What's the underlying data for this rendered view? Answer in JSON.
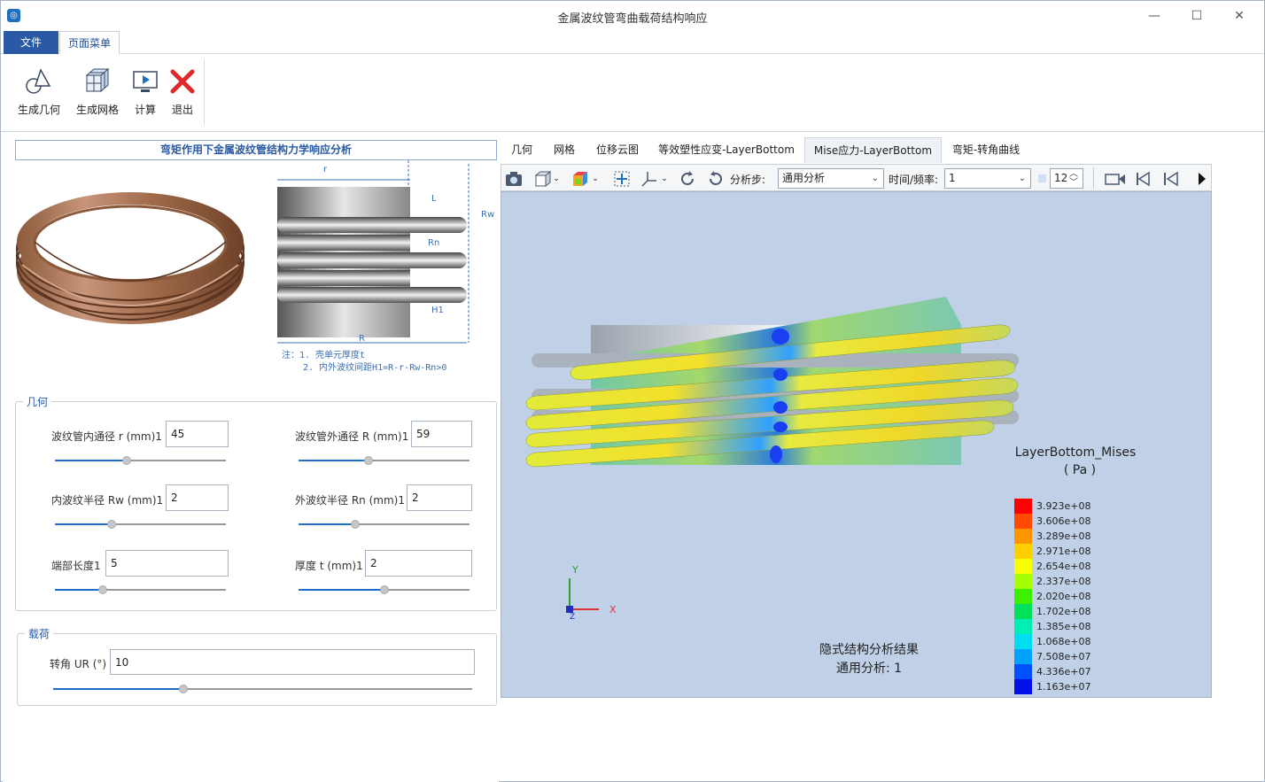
{
  "window": {
    "title": "金属波纹管弯曲载荷结构响应"
  },
  "menu": {
    "file": "文件",
    "page_menu": "页面菜单"
  },
  "ribbon": {
    "gen_geometry": "生成几何",
    "gen_mesh": "生成网格",
    "compute": "计算",
    "exit": "退出"
  },
  "left": {
    "heading": "弯矩作用下金属波纹管结构力学响应分析",
    "diagram": {
      "r": "r",
      "L": "L",
      "Rw": "Rw",
      "Rn": "Rn",
      "H1": "H1",
      "R": "R",
      "note1": "注：1. 壳单元厚度t",
      "note2": "2. 内外波纹间距H1=R-r-Rw-Rn>0"
    },
    "geometry": {
      "title": "几何",
      "inner_r_label": "波纹管内通径 r (mm)1",
      "inner_r_value": "45",
      "inner_r_slider": 0.42,
      "outer_r_label": "波纹管外通径 R (mm)1",
      "outer_r_value": "59",
      "outer_r_slider": 0.41,
      "rw_label": "内波纹半径 Rw (mm)1",
      "rw_value": "2",
      "rw_slider": 0.33,
      "rn_label": "外波纹半径 Rn (mm)1",
      "rn_value": "2",
      "rn_slider": 0.33,
      "end_label": "端部长度1",
      "end_value": "5",
      "end_slider": 0.28,
      "t_label": "厚度 t (mm)1",
      "t_value": "2",
      "t_slider": 0.5
    },
    "load": {
      "title": "载荷",
      "ur_label": "转角 UR (°)",
      "ur_value": "10",
      "ur_slider": 0.31
    }
  },
  "right": {
    "tabs": [
      "几何",
      "网格",
      "位移云图",
      "等效塑性应变-LayerBottom",
      "Mise应力-LayerBottom",
      "弯矩-转角曲线"
    ],
    "active_tab": 4,
    "toolbar": {
      "step_label": "分析步:",
      "step_value": "通用分析",
      "time_label": "时间/频率:",
      "time_value": "1",
      "frame_value": "12"
    },
    "viewport": {
      "legend_title": "LayerBottom_Mises",
      "legend_unit": "( Pa )",
      "legend_values": [
        "3.923e+08",
        "3.606e+08",
        "3.289e+08",
        "2.971e+08",
        "2.654e+08",
        "2.337e+08",
        "2.020e+08",
        "1.702e+08",
        "1.385e+08",
        "1.068e+08",
        "7.508e+07",
        "4.336e+07",
        "1.163e+07"
      ],
      "legend_colors": [
        "#ff0000",
        "#ff4a00",
        "#ff9600",
        "#ffcf00",
        "#f5ff00",
        "#a6ff00",
        "#3cf000",
        "#00e05a",
        "#00f0b4",
        "#00dcf0",
        "#00a2ff",
        "#0050ff",
        "#0010e6"
      ],
      "axis_x": "X",
      "axis_y": "Y",
      "axis_z": "Z",
      "result_line1": "隐式结构分析结果",
      "result_line2": "通用分析: 1"
    }
  }
}
